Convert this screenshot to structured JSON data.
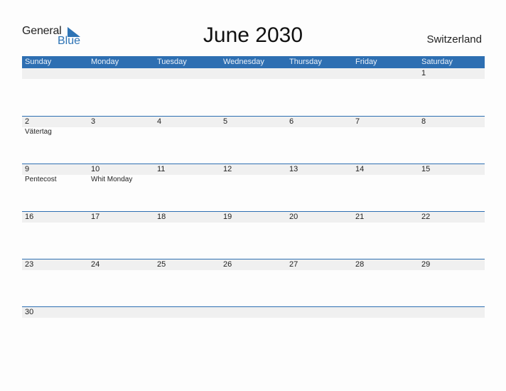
{
  "logo": {
    "word1": "General",
    "word2": "Blue"
  },
  "title": "June 2030",
  "country": "Switzerland",
  "weekdays": [
    "Sunday",
    "Monday",
    "Tuesday",
    "Wednesday",
    "Thursday",
    "Friday",
    "Saturday"
  ],
  "weeks": [
    {
      "days": [
        "",
        "",
        "",
        "",
        "",
        "",
        "1"
      ],
      "events": [
        "",
        "",
        "",
        "",
        "",
        "",
        ""
      ]
    },
    {
      "days": [
        "2",
        "3",
        "4",
        "5",
        "6",
        "7",
        "8"
      ],
      "events": [
        "Vätertag",
        "",
        "",
        "",
        "",
        "",
        ""
      ]
    },
    {
      "days": [
        "9",
        "10",
        "11",
        "12",
        "13",
        "14",
        "15"
      ],
      "events": [
        "Pentecost",
        "Whit Monday",
        "",
        "",
        "",
        "",
        ""
      ]
    },
    {
      "days": [
        "16",
        "17",
        "18",
        "19",
        "20",
        "21",
        "22"
      ],
      "events": [
        "",
        "",
        "",
        "",
        "",
        "",
        ""
      ]
    },
    {
      "days": [
        "23",
        "24",
        "25",
        "26",
        "27",
        "28",
        "29"
      ],
      "events": [
        "",
        "",
        "",
        "",
        "",
        "",
        ""
      ]
    },
    {
      "days": [
        "30",
        "",
        "",
        "",
        "",
        "",
        ""
      ],
      "events": [
        "",
        "",
        "",
        "",
        "",
        "",
        ""
      ]
    }
  ],
  "colors": {
    "accent": "#2e6fb2",
    "strip": "#f0f0f0"
  }
}
